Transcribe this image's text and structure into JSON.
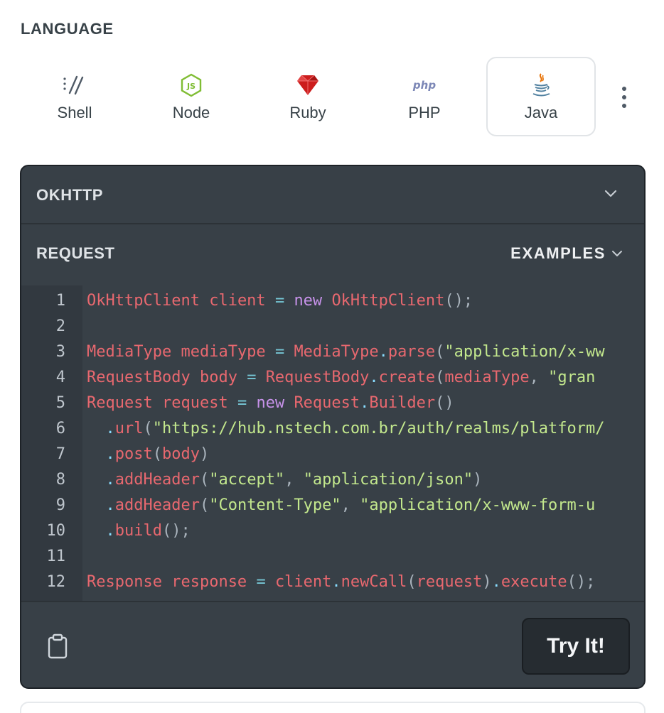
{
  "language_section": {
    "heading": "LANGUAGE",
    "tabs": [
      {
        "label": "Shell",
        "icon": "shell-icon",
        "active": false
      },
      {
        "label": "Node",
        "icon": "nodejs-icon",
        "active": false
      },
      {
        "label": "Ruby",
        "icon": "ruby-icon",
        "active": false
      },
      {
        "label": "PHP",
        "icon": "php-icon",
        "active": false
      },
      {
        "label": "Java",
        "icon": "java-icon",
        "active": true
      }
    ],
    "more_icon": "vertical-dots-icon"
  },
  "code_card": {
    "library": "OKHTTP",
    "request_label": "REQUEST",
    "examples_label": "EXAMPLES",
    "try_button": "Try It!",
    "copy_icon": "clipboard-icon",
    "lines": [
      {
        "n": "1",
        "code": "OkHttpClient client = new OkHttpClient();"
      },
      {
        "n": "2",
        "code": ""
      },
      {
        "n": "3",
        "code": "MediaType mediaType = MediaType.parse(\"application/x-ww"
      },
      {
        "n": "4",
        "code": "RequestBody body = RequestBody.create(mediaType, \"gran"
      },
      {
        "n": "5",
        "code": "Request request = new Request.Builder()"
      },
      {
        "n": "6",
        "code": "  .url(\"https://hub.nstech.com.br/auth/realms/platform/"
      },
      {
        "n": "7",
        "code": "  .post(body)"
      },
      {
        "n": "8",
        "code": "  .addHeader(\"accept\", \"application/json\")"
      },
      {
        "n": "9",
        "code": "  .addHeader(\"Content-Type\", \"application/x-www-form-u"
      },
      {
        "n": "10",
        "code": "  .build();"
      },
      {
        "n": "11",
        "code": ""
      },
      {
        "n": "12",
        "code": "Response response = client.newCall(request).execute();"
      }
    ]
  },
  "colors": {
    "card_bg": "#384047",
    "identifier": "#e8686f",
    "keyword": "#c792ea",
    "string": "#c3e88d",
    "operator": "#76c7d6"
  }
}
